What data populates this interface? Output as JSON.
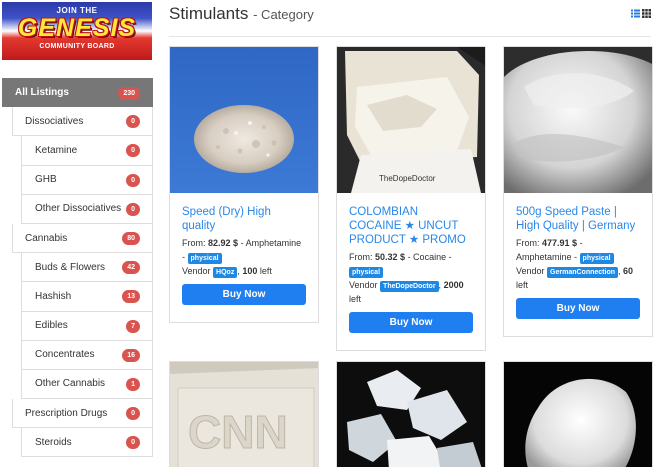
{
  "banner": {
    "line1": "JOIN THE",
    "line2": "GENESIS",
    "line3": "COMMUNITY BOARD"
  },
  "page": {
    "title": "Stimulants",
    "subtitle": "- Category",
    "view_icons": [
      "list-view-icon",
      "grid-view-icon"
    ]
  },
  "sidebar": {
    "items": [
      {
        "label": "All Listings",
        "count": "230",
        "level": 0,
        "active": true
      },
      {
        "label": "Dissociatives",
        "count": "0",
        "level": 1
      },
      {
        "label": "Ketamine",
        "count": "0",
        "level": 2
      },
      {
        "label": "GHB",
        "count": "0",
        "level": 2
      },
      {
        "label": "Other Dissociatives",
        "count": "0",
        "level": 2
      },
      {
        "label": "Cannabis",
        "count": "80",
        "level": 1
      },
      {
        "label": "Buds & Flowers",
        "count": "42",
        "level": 2
      },
      {
        "label": "Hashish",
        "count": "13",
        "level": 2
      },
      {
        "label": "Edibles",
        "count": "7",
        "level": 2
      },
      {
        "label": "Concentrates",
        "count": "16",
        "level": 2
      },
      {
        "label": "Other Cannabis",
        "count": "1",
        "level": 2
      },
      {
        "label": "Prescription Drugs",
        "count": "0",
        "level": 1
      },
      {
        "label": "Steroids",
        "count": "0",
        "level": 2
      }
    ]
  },
  "listings": [
    {
      "name": "Speed (Dry) High quality",
      "from_label": "From:",
      "price": "82.92 $",
      "category": "- Amphetamine -",
      "tag": "physical",
      "vendor_label": "Vendor",
      "vendor": "HQoz",
      "stock": "100",
      "stock_suffix": "left",
      "buy_label": "Buy Now",
      "image_icon": "powder-photo"
    },
    {
      "name": "COLOMBIAN COCAINE ★ UNCUT PRODUCT ★ PROMO",
      "from_label": "From:",
      "price": "50.32 $",
      "category": "- Cocaine -",
      "tag": "physical",
      "vendor_label": "Vendor",
      "vendor": "TheDopeDoctor",
      "stock": "2000",
      "stock_suffix": "left",
      "buy_label": "Buy Now",
      "image_icon": "brick-photo",
      "image_caption": "TheDopeDoctor"
    },
    {
      "name": "500g Speed Paste | High Quality | Germany",
      "from_label": "From:",
      "price": "477.91 $",
      "category": "- Amphetamine -",
      "tag": "physical",
      "vendor_label": "Vendor",
      "vendor": "GermanConnection",
      "stock": "60",
      "stock_suffix": "left",
      "buy_label": "Buy Now",
      "image_icon": "paste-photo"
    }
  ],
  "listings_row2": [
    {
      "image_icon": "brick-stamp-photo",
      "stamp": "CNN"
    },
    {
      "image_icon": "crystal-photo"
    },
    {
      "image_icon": "rock-photo"
    }
  ],
  "colors": {
    "accent": "#1f7ff0",
    "link": "#2a87e8",
    "badge": "#d9534f",
    "active": "#777777"
  }
}
